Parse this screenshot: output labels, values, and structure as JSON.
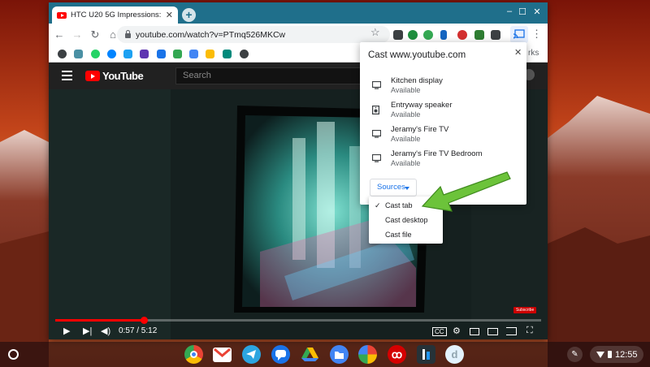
{
  "browser": {
    "tab_title": "HTC U20 5G Impressions: Back f",
    "new_tab": "+",
    "window_controls": {
      "minimize": "–",
      "maximize": "☐",
      "close": "✕"
    },
    "url": "youtube.com/watch?v=PTmq526MKCw",
    "bookmarks_overflow": "rks"
  },
  "youtube": {
    "logo_text": "YouTube",
    "search_placeholder": "Search",
    "subscribe_badge": "Subscribe",
    "time": "0:57 / 5:12",
    "progress_fraction": 0.183
  },
  "cast_popup": {
    "title": "Cast www.youtube.com",
    "devices": [
      {
        "name": "Kitchen display",
        "status": "Available",
        "icon": "tv-icon"
      },
      {
        "name": "Entryway speaker",
        "status": "Available",
        "icon": "speaker-icon"
      },
      {
        "name": "Jeramy's Fire TV",
        "status": "Available",
        "icon": "tv-icon"
      },
      {
        "name": "Jeramy's Fire TV Bedroom",
        "status": "Available",
        "icon": "tv-icon"
      }
    ],
    "sources_label": "Sources",
    "sources_menu": [
      {
        "label": "Cast tab",
        "checked": true
      },
      {
        "label": "Cast desktop",
        "checked": false
      },
      {
        "label": "Cast file",
        "checked": false
      }
    ]
  },
  "shelf": {
    "apps": [
      {
        "name": "chrome",
        "color": "#4285f4"
      },
      {
        "name": "gmail",
        "color": "#ea4335"
      },
      {
        "name": "telegram",
        "color": "#2ca5e0"
      },
      {
        "name": "messages",
        "color": "#1a73e8"
      },
      {
        "name": "google-drive",
        "color": "#fbbc04"
      },
      {
        "name": "files",
        "color": "#4285f4"
      },
      {
        "name": "google-photos",
        "color": "#34a853"
      },
      {
        "name": "adobe-acrobat",
        "color": "#d50000"
      },
      {
        "name": "app-bookmark",
        "color": "#263238"
      },
      {
        "name": "app-d",
        "color": "#e3f2fd"
      }
    ],
    "clock": "12:55"
  },
  "colors": {
    "titlebar": "#1f6f8b",
    "annotation_arrow": "#6cc33a",
    "youtube_red": "#ff0000",
    "cast_blue": "#1a73e8"
  }
}
